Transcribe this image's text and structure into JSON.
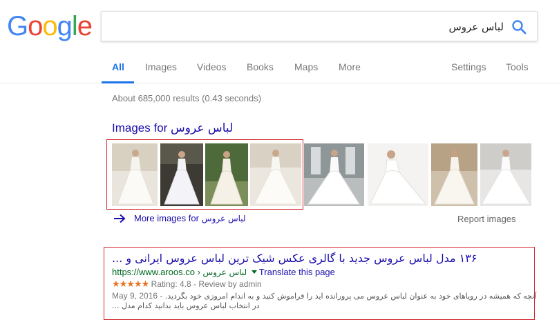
{
  "logo": {
    "letters": [
      "G",
      "o",
      "o",
      "g",
      "l",
      "e"
    ],
    "colors": [
      "#4285F4",
      "#EA4335",
      "#FBBC05",
      "#4285F4",
      "#34A853",
      "#EA4335"
    ]
  },
  "search": {
    "query": "لباس عروس"
  },
  "tabs": [
    {
      "label": "All",
      "active": true
    },
    {
      "label": "Images"
    },
    {
      "label": "Videos"
    },
    {
      "label": "Books"
    },
    {
      "label": "Maps"
    },
    {
      "label": "More"
    },
    {
      "label": "Settings"
    },
    {
      "label": "Tools"
    }
  ],
  "stats": "About 685,000 results (0.43 seconds)",
  "images": {
    "heading_prefix": "Images for",
    "heading_query": "لباس عروس",
    "more_prefix": "More images for",
    "more_query": "لباس عروس",
    "report": "Report images"
  },
  "result": {
    "title": "۱۳۶ مدل لباس عروس جدید با گالری عکس شیک ترین لباس عروس ایرانی و ...",
    "url": "https://www.aroos.co",
    "url_sep": "›",
    "url_path": "لباس عروس",
    "translate": "Translate this page",
    "stars": "★★★★★",
    "rating": "Rating: 4.8 - Review by admin",
    "snippet_line1": "آنچه که همیشه در رویاهای خود به عنوان لباس عروس می پرورانده اید را فراموش کنید و به اندام امروزی خود بگردید.",
    "snippet_date": "May 9, 2016 -",
    "snippet_line2": "در انتخاب لباس عروس باید بدانید کدام مدل ..."
  },
  "colors": {
    "link": "#1a0dab",
    "url": "#006621",
    "accent": "#1a73e8",
    "highlight_box": "#d2262d",
    "star": "#e7711b"
  }
}
